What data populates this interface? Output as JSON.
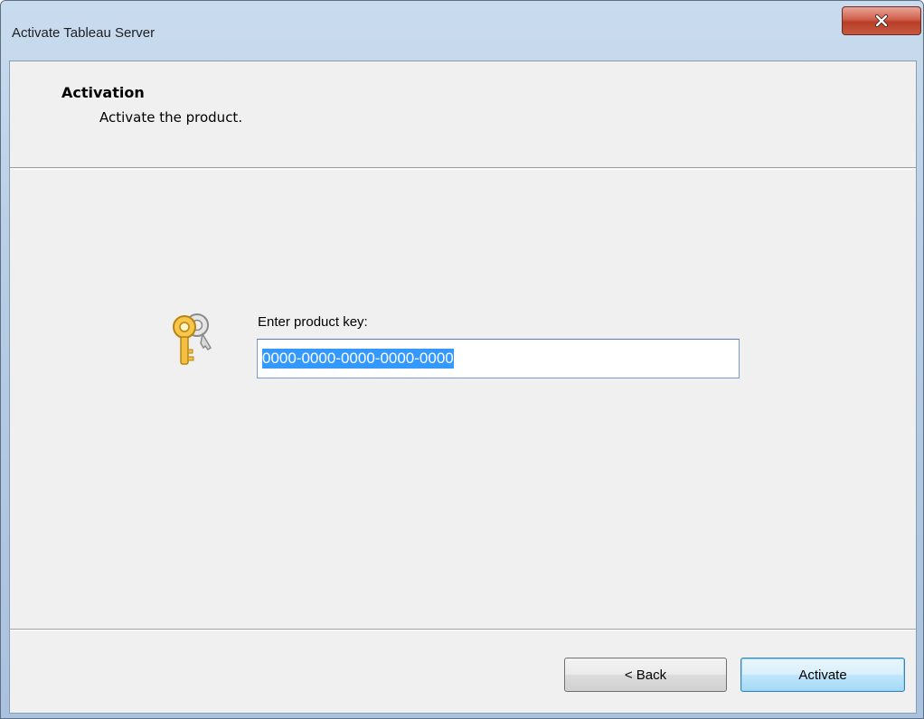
{
  "window": {
    "title": "Activate Tableau Server",
    "close_icon": "close-icon"
  },
  "header": {
    "title": "Activation",
    "subtitle": "Activate the product."
  },
  "form": {
    "key_icon": "keys-icon",
    "label": "Enter product key:",
    "product_key_value": "0000-0000-0000-0000-0000"
  },
  "buttons": {
    "back_label": "< Back",
    "activate_label": "Activate"
  },
  "colors": {
    "selection": "#3399ff",
    "close_button": "#c65a40",
    "default_button_border": "#3c7fb1"
  }
}
